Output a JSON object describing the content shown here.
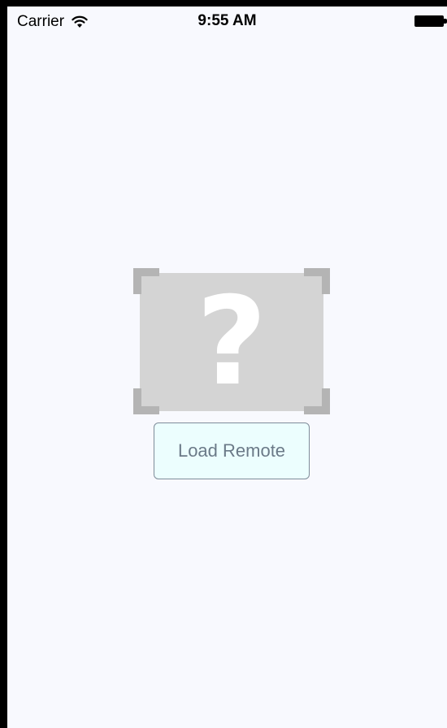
{
  "status_bar": {
    "carrier": "Carrier",
    "time": "9:55 AM",
    "wifi_icon": "wifi-icon",
    "battery_icon": "battery-full-icon"
  },
  "image_placeholder": {
    "icon": "question-mark-icon",
    "glyph": "?",
    "background_color": "#d4d4d4",
    "corner_color": "#b4b4b4"
  },
  "load_button": {
    "label": "Load Remote",
    "background_color": "#ecfefe",
    "border_color": "#7f8c99",
    "text_color": "#6b7a88"
  },
  "colors": {
    "screen_background": "#f8f9fe",
    "frame": "#000000"
  }
}
